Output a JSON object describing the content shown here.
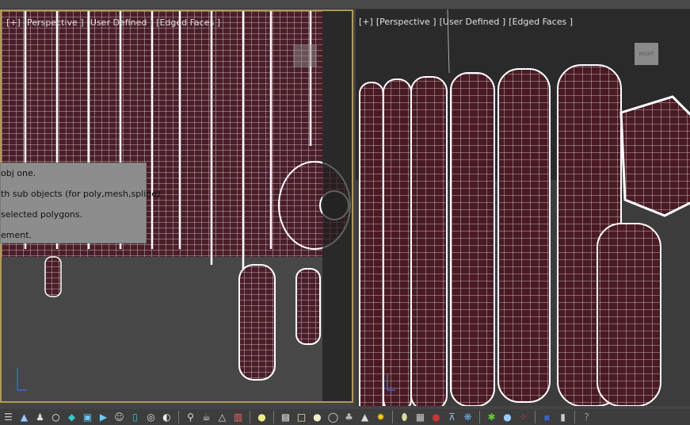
{
  "viewport_left": {
    "labels": [
      "[+]",
      "[Perspective ]",
      "[User Defined ]",
      "[Edged Faces ]"
    ],
    "tooltip_lines": [
      "obj one.",
      "th sub objects (for poly,mesh,spline).",
      "selected polygons.",
      "ement."
    ],
    "active": true
  },
  "viewport_right": {
    "labels": [
      "[+]",
      "[Perspective ]",
      "[User Defined ]",
      "[Edged Faces ]"
    ],
    "navcube_text": "RIGHT"
  },
  "toolbar": {
    "icons": [
      "list-icon",
      "cone-icon",
      "figure-icon",
      "ring-icon",
      "teapot-cyan-icon",
      "camera-box-icon",
      "play-box-icon",
      "people-icon",
      "frame-icon",
      "torus-icon",
      "shell-icon",
      "bulb-icon",
      "teapot-icon",
      "shape-icon",
      "trash-icon",
      "light-icon",
      "camera-icon",
      "box-icon",
      "sphere-icon",
      "ring-sphere-icon",
      "plant-icon",
      "cone-white-icon",
      "sun-icon",
      "egg-icon",
      "checker-icon",
      "ball-icon",
      "tower-icon",
      "sphere-blue-icon",
      "grass-icon",
      "orb-icon",
      "dots-icon",
      "render-icon",
      "settings-icon",
      "help-icon"
    ]
  },
  "colors": {
    "active_border": "#b09a55",
    "mesh_fill": "#4a1820",
    "wire": "#ffffff"
  }
}
